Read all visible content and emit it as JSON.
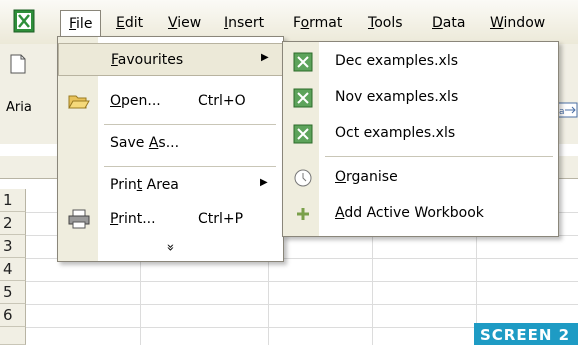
{
  "menubar": {
    "items": [
      {
        "label": "File",
        "active": true
      },
      {
        "label": "Edit"
      },
      {
        "label": "View"
      },
      {
        "label": "Insert"
      },
      {
        "label": "Format"
      },
      {
        "label": "Tools"
      },
      {
        "label": "Data"
      },
      {
        "label": "Window"
      }
    ]
  },
  "toolbar": {
    "font_fragment": "Aria"
  },
  "grid": {
    "row_numbers": [
      "1",
      "2",
      "3",
      "4",
      "5",
      "6"
    ]
  },
  "file_menu": {
    "items": [
      {
        "label": "Favourites",
        "has_submenu": true,
        "highlighted": true
      },
      {
        "label": "Open...",
        "shortcut": "Ctrl+O",
        "icon": "open-folder-icon"
      },
      {
        "label": "Save As..."
      },
      {
        "label": "Print Area",
        "has_submenu": true
      },
      {
        "label": "Print...",
        "shortcut": "Ctrl+P",
        "icon": "printer-icon"
      }
    ],
    "expand_glyph": "»"
  },
  "favourites_submenu": {
    "items": [
      {
        "label": "Dec examples.xls",
        "icon": "excel-file-icon"
      },
      {
        "label": "Nov examples.xls",
        "icon": "excel-file-icon"
      },
      {
        "label": "Oct examples.xls",
        "icon": "excel-file-icon"
      },
      {
        "label": "Organise",
        "icon": "organise-icon"
      },
      {
        "label": "Add Active Workbook",
        "icon": "add-icon"
      }
    ]
  },
  "caption": "SCREEN 2",
  "colors": {
    "caption_bg": "#1e9bc4",
    "menu_gutter": "#efedde",
    "highlight": "#ece9d8"
  }
}
